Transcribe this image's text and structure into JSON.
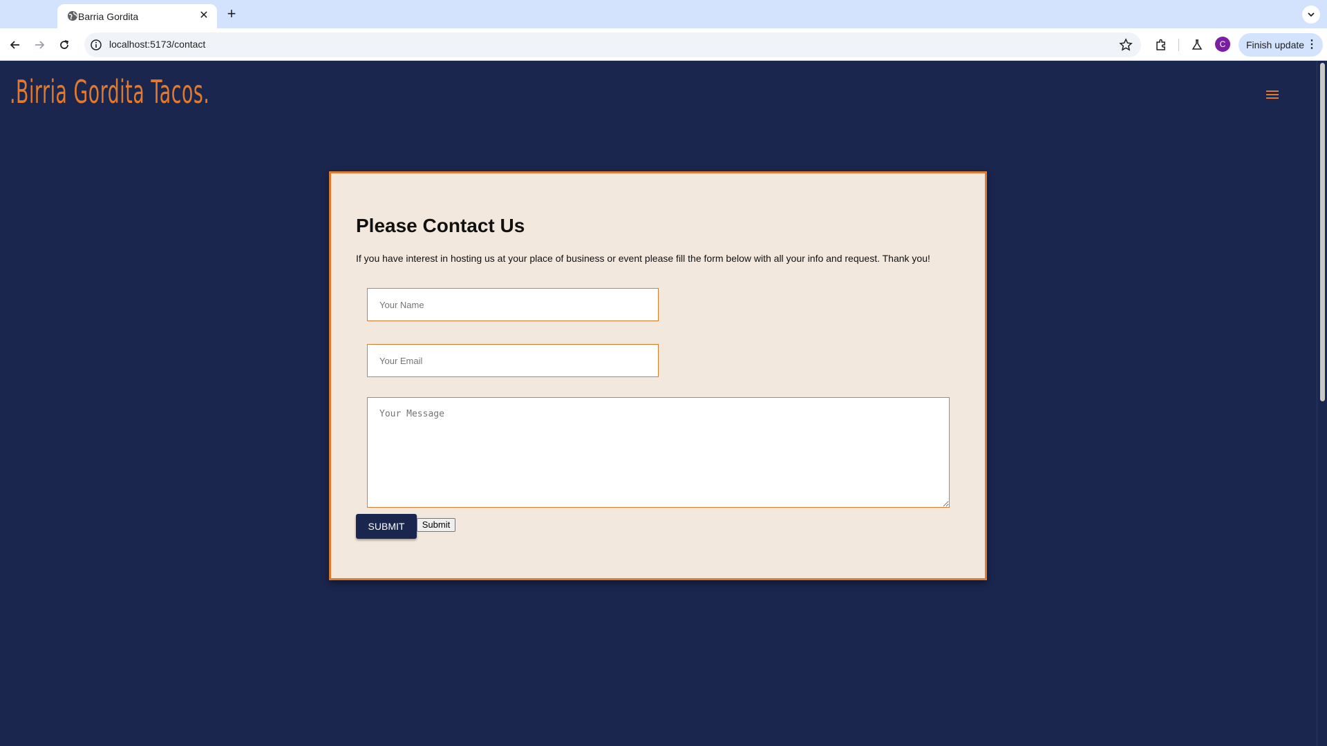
{
  "browser": {
    "tab_title": "Barria Gordita",
    "url": "localhost:5173/contact",
    "avatar_letter": "C",
    "update_label": "Finish update"
  },
  "site": {
    "logo_text": ".Birria Gordita Tacos."
  },
  "contact": {
    "title": "Please Contact Us",
    "description": "If you have interest in hosting us at your place of business or event please fill the form below with all your info and request. Thank you!",
    "name_placeholder": "Your Name",
    "email_placeholder": "Your Email",
    "message_placeholder": "Your Message",
    "submit_primary_label": "SUBMIT",
    "submit_default_label": "Submit"
  },
  "colors": {
    "background": "#1b264f",
    "accent": "#e07a2e",
    "card": "#f2e8dd"
  }
}
